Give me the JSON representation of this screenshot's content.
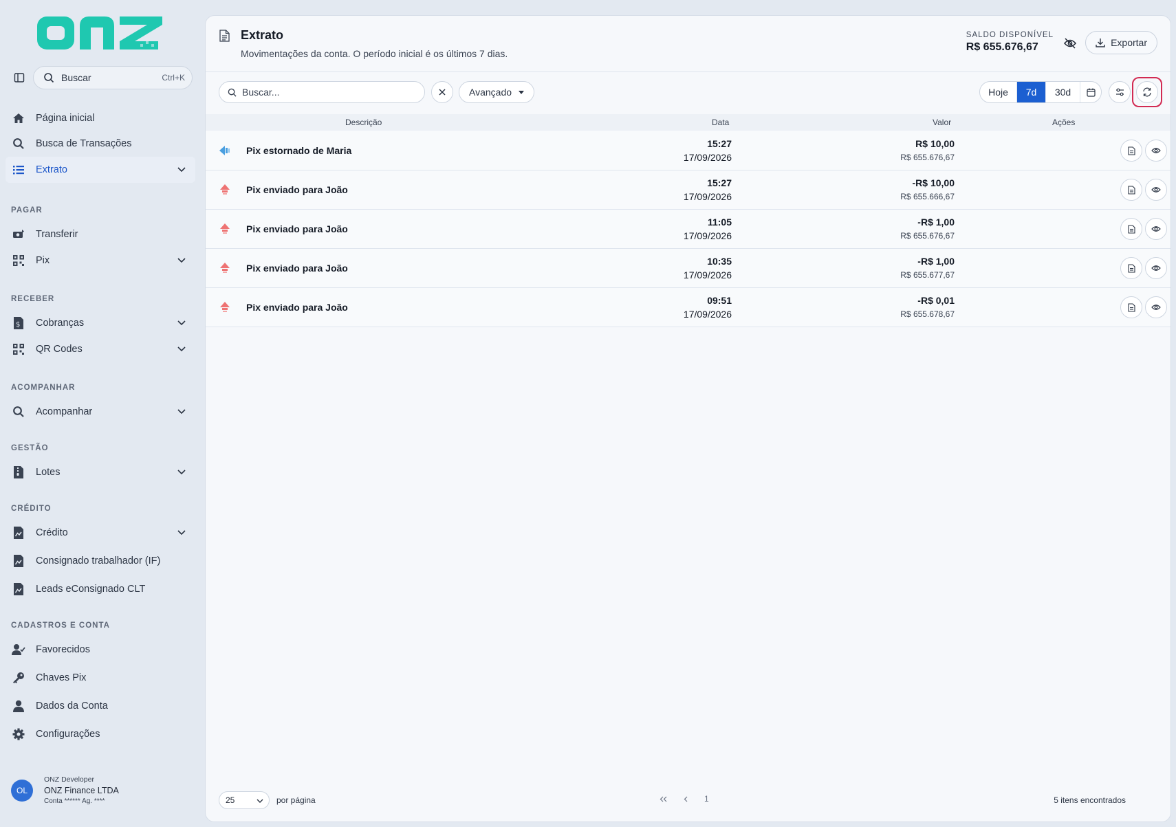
{
  "brand": {
    "logo_text": "onz",
    "accent": "#1fc8b0"
  },
  "sidebar": {
    "search": {
      "label": "Buscar",
      "shortcut": "Ctrl+K"
    },
    "items": [
      {
        "label": "Página inicial",
        "icon": "home-icon"
      },
      {
        "label": "Busca de Transações",
        "icon": "search-icon"
      },
      {
        "label": "Extrato",
        "icon": "list-icon",
        "active": true
      },
      {
        "label": "Transferir",
        "icon": "money-transfer-icon"
      },
      {
        "label": "Pix",
        "icon": "qr-grid-icon"
      },
      {
        "label": "Cobranças",
        "icon": "invoice-icon"
      },
      {
        "label": "QR Codes",
        "icon": "qr-grid-icon"
      },
      {
        "label": "Acompanhar",
        "icon": "search-icon"
      },
      {
        "label": "Lotes",
        "icon": "file-zip-icon"
      },
      {
        "label": "Crédito",
        "icon": "file-chart-icon"
      },
      {
        "label": "Consignado trabalhador (IF)",
        "icon": "file-chart-icon"
      },
      {
        "label": "Leads eConsignado CLT",
        "icon": "file-chart-icon"
      },
      {
        "label": "Favorecidos",
        "icon": "user-check-icon"
      },
      {
        "label": "Chaves Pix",
        "icon": "key-icon"
      },
      {
        "label": "Dados da Conta",
        "icon": "user-icon"
      },
      {
        "label": "Configurações",
        "icon": "gear-icon"
      }
    ],
    "sections": {
      "pagar": "PAGAR",
      "receber": "RECEBER",
      "acompanhar": "ACOMPANHAR",
      "gestao": "GESTÃO",
      "credito": "CRÉDITO",
      "cadastros": "CADASTROS E CONTA"
    },
    "user": {
      "initials": "OL",
      "role": "ONZ Developer",
      "company": "ONZ Finance LTDA",
      "account": "Conta ****** Ag. ****"
    }
  },
  "header": {
    "title": "Extrato",
    "subtitle": "Movimentações da conta. O período inicial é os últimos 7 dias.",
    "balance_label": "SALDO DISPONÍVEL",
    "balance_value": "R$ 655.676,67",
    "export_label": "Exportar"
  },
  "toolbar": {
    "search_placeholder": "Buscar...",
    "advanced_label": "Avançado",
    "periods": [
      "Hoje",
      "7d",
      "30d"
    ],
    "selected_period": "7d"
  },
  "table": {
    "columns": {
      "description": "Descrição",
      "date": "Data",
      "value": "Valor",
      "actions": "Ações"
    },
    "rows": [
      {
        "direction": "in",
        "description": "Pix estornado de Maria",
        "time": "15:27",
        "date": "17/09/2026",
        "amount": "R$ 10,00",
        "balance": "R$ 655.676,67"
      },
      {
        "direction": "out",
        "description": "Pix enviado para João",
        "time": "15:27",
        "date": "17/09/2026",
        "amount": "-R$ 10,00",
        "balance": "R$ 655.666,67"
      },
      {
        "direction": "out",
        "description": "Pix enviado para João",
        "time": "11:05",
        "date": "17/09/2026",
        "amount": "-R$ 1,00",
        "balance": "R$ 655.676,67"
      },
      {
        "direction": "out",
        "description": "Pix enviado para João",
        "time": "10:35",
        "date": "17/09/2026",
        "amount": "-R$ 1,00",
        "balance": "R$ 655.677,67"
      },
      {
        "direction": "out",
        "description": "Pix enviado para João",
        "time": "09:51",
        "date": "17/09/2026",
        "amount": "-R$ 0,01",
        "balance": "R$ 655.678,67"
      }
    ]
  },
  "footer": {
    "page_size": "25",
    "page_size_label": "por página",
    "current_page": "1",
    "found_label": "5 itens encontrados"
  },
  "colors": {
    "primary": "#1b5fd1",
    "incoming": "#4a9fe0",
    "outgoing": "#ee7373",
    "highlight": "#d22a52"
  }
}
